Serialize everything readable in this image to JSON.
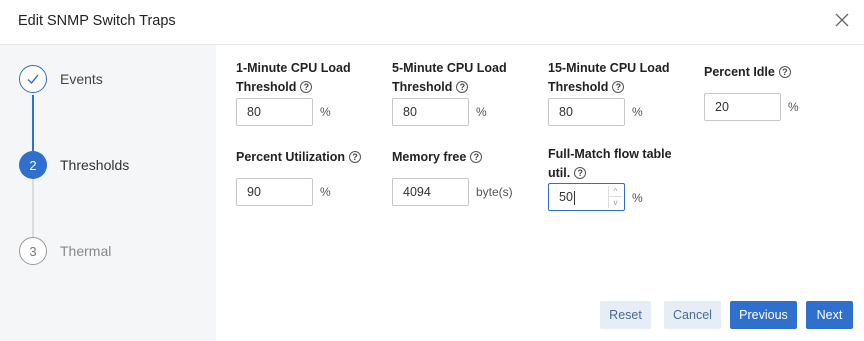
{
  "dialog": {
    "title": "Edit SNMP Switch Traps"
  },
  "steps": [
    {
      "number": "",
      "label": "Events",
      "state": "done"
    },
    {
      "number": "2",
      "label": "Thresholds",
      "state": "active"
    },
    {
      "number": "3",
      "label": "Thermal",
      "state": "pending"
    }
  ],
  "fields": {
    "cpu1": {
      "label_line1": "1-Minute CPU Load",
      "label_line2": "Threshold",
      "value": "80",
      "unit": "%"
    },
    "cpu5": {
      "label_line1": "5-Minute CPU Load",
      "label_line2": "Threshold",
      "value": "80",
      "unit": "%"
    },
    "cpu15": {
      "label_line1": "15-Minute CPU Load",
      "label_line2": "Threshold",
      "value": "80",
      "unit": "%"
    },
    "idle": {
      "label": "Percent Idle",
      "value": "20",
      "unit": "%"
    },
    "util": {
      "label": "Percent Utilization",
      "value": "90",
      "unit": "%"
    },
    "memory": {
      "label": "Memory free",
      "value": "4094",
      "unit": "byte(s)"
    },
    "flow": {
      "label_line1": "Full-Match flow table",
      "label_line2": "util.",
      "value": "50",
      "unit": "%"
    }
  },
  "help_glyph": "?",
  "spinner": {
    "up": "^",
    "down": "v"
  },
  "buttons": {
    "reset": "Reset",
    "cancel": "Cancel",
    "previous": "Previous",
    "next": "Next"
  },
  "colors": {
    "accent": "#2f6fce",
    "sidebar_bg": "#f5f6f8",
    "light_button": "#e7edf7"
  },
  "icons": {
    "close": "close-icon",
    "done": "check-icon",
    "help": "help-circle-icon"
  }
}
